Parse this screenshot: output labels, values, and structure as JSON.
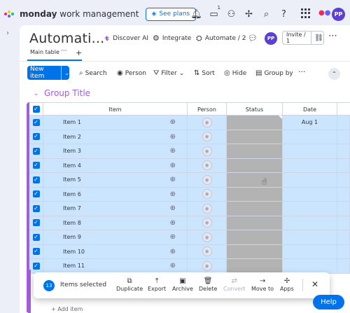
{
  "brand": {
    "name_bold": "monday",
    "name_rest": " work management",
    "see_plans": "See plans"
  },
  "topbar": {
    "notif_badge": "1",
    "avatar": "PP"
  },
  "board": {
    "title": "Automati...",
    "discover_ai": "Discover AI",
    "integrate": "Integrate",
    "automate": "Automate / 2",
    "avatar": "PP",
    "invite": "Invite / 1"
  },
  "views": {
    "main_table": "Main table",
    "more": "···",
    "add": "+"
  },
  "toolbar": {
    "new_item": "New item",
    "search": "Search",
    "person": "Person",
    "filter": "Filter",
    "sort": "Sort",
    "hide": "Hide",
    "group_by": "Group by",
    "more": "···"
  },
  "group": {
    "title": "Group Title"
  },
  "table": {
    "headers": {
      "item": "Item",
      "person": "Person",
      "status": "Status",
      "date": "Date"
    },
    "rows": [
      {
        "name": "Item 1",
        "date": "Aug 1"
      },
      {
        "name": "Item 2",
        "date": ""
      },
      {
        "name": "Item 3",
        "date": ""
      },
      {
        "name": "Item 4",
        "date": ""
      },
      {
        "name": "Item 5",
        "date": ""
      },
      {
        "name": "Item 6",
        "date": ""
      },
      {
        "name": "Item 7",
        "date": ""
      },
      {
        "name": "Item 8",
        "date": ""
      },
      {
        "name": "Item 9",
        "date": ""
      },
      {
        "name": "Item 10",
        "date": ""
      },
      {
        "name": "Item 11",
        "date": ""
      }
    ],
    "add_item": "+ Add item"
  },
  "selection": {
    "count": "13",
    "label": "Items selected",
    "actions": {
      "duplicate": "Duplicate",
      "export": "Export",
      "archive": "Archive",
      "delete": "Delete",
      "convert": "Convert",
      "move_to": "Move to",
      "apps": "Apps"
    }
  },
  "help": "Help",
  "colors": {
    "primary": "#0073ea",
    "group": "#a25ddc",
    "selected_row": "#cce5ff",
    "status_cell": "#b3b3b3"
  },
  "icons": [
    "sparkle-icon",
    "bell-icon",
    "inbox-icon",
    "invite-members-icon",
    "puzzle-icon",
    "search-icon",
    "question-icon",
    "apps-grid-icon",
    "chevron-down-icon",
    "ai-icon",
    "integrate-icon",
    "automate-icon",
    "chat-icon",
    "link-icon",
    "person-icon",
    "filter-icon",
    "sort-icon",
    "hide-icon",
    "group-by-icon",
    "add-update-icon",
    "duplicate-icon",
    "export-icon",
    "archive-icon",
    "delete-icon",
    "convert-icon",
    "move-to-icon",
    "apps-icon",
    "close-icon"
  ]
}
